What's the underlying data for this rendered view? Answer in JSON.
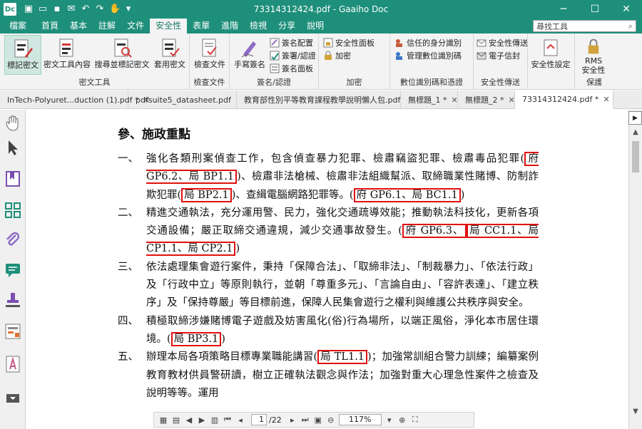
{
  "app": {
    "logo": "Dc",
    "title": "73314312424.pdf - Gaaiho Doc",
    "accent": "#1e8f7a"
  },
  "quick_access": [
    "new-doc-icon",
    "open-icon",
    "save-icon",
    "email-icon",
    "undo-icon",
    "redo-icon",
    "hand-tool-icon",
    "customize-icon"
  ],
  "window_controls": {
    "minimize": "─",
    "maximize": "☐",
    "close": "✕"
  },
  "ribbon_tabs": {
    "file": "檔案",
    "items": [
      "首頁",
      "基本",
      "註解",
      "文件",
      "安全性",
      "表單",
      "進階",
      "檢視",
      "分享",
      "說明"
    ],
    "active": "安全性"
  },
  "search": {
    "placeholder": "尋找工具"
  },
  "ribbon": {
    "redaction": {
      "label": "密文工具",
      "mark": "標記密文",
      "text_content": "密文工具內容",
      "search_mark": "搜尋並標記密文",
      "apply": "套用密文"
    },
    "check": {
      "label": "檢查文件",
      "button": "檢查文件"
    },
    "sign": {
      "label": "簽名/認證",
      "handwrite": "手寫簽名",
      "config": "簽名配置",
      "sign_certify": "簽署/認證",
      "panel": "簽名面板"
    },
    "encrypt": {
      "label": "加密",
      "panel": "安全性面板",
      "encrypt": "加密"
    },
    "digital_id": {
      "label": "數位識別碼和憑證",
      "trusted": "信任的身分識別",
      "manage": "管理數位識別碼"
    },
    "security_transmit": {
      "label": "安全性傳送",
      "transmit": "安全性傳送",
      "envelope": "電子信封"
    },
    "settings": {
      "label": "安全性設定",
      "button": "安全性設定"
    },
    "rms": {
      "label": "保護",
      "button_line1": "RMS",
      "button_line2": "安全性"
    }
  },
  "doc_tabs": [
    {
      "label": "InTech-Polyuret...duction (1).pdf *",
      "close": "✕"
    },
    {
      "label": "pdfsuite5_datasheet.pdf",
      "close": ""
    },
    {
      "label": "教育部性別平等教育課程教學說明懶人包.pdf",
      "close": ""
    },
    {
      "label": "無標題_1 *",
      "close": "✕"
    },
    {
      "label": "無標題_2 *",
      "close": "✕"
    },
    {
      "label": "73314312424.pdf *",
      "close": "✕"
    }
  ],
  "sidebar_icons": [
    "hand-icon",
    "select-arrow-icon",
    "bookmark-icon",
    "thumbnails-icon",
    "attachment-icon",
    "comments-icon",
    "stamp-icon",
    "form-fields-icon",
    "signature-icon",
    "collapse-icon"
  ],
  "document": {
    "heading": "參、施政重點",
    "items": [
      {
        "num": "一、",
        "parts": [
          {
            "t": "強化各類刑案偵查工作，包含偵查暴力犯罪、檢肅竊盜犯罪、檢肅毒品犯罪("
          },
          {
            "t": "府 GP6.2、局 BP1.1",
            "box": true
          },
          {
            "t": ")、檢肅非法槍械、檢肅非法組織幫派、取締職業性賭博、防制詐欺犯罪("
          },
          {
            "t": "局 BP2.1",
            "box": true
          },
          {
            "t": ")、查緝電腦網路犯罪等。("
          },
          {
            "t": "府 GP6.1、局 BC1.1",
            "box": true
          },
          {
            "t": ")"
          }
        ]
      },
      {
        "num": "二、",
        "parts": [
          {
            "t": "精進交通執法，充分運用警、民力，強化交通疏導效能；推動執法科技化，更新各項交通設備；嚴正取締交通違規，減少交通事故發生。("
          },
          {
            "t": "府 GP6.3、",
            "box": true
          },
          {
            "t": ""
          },
          {
            "t": "局 CC1.1、局 CP1.1、局 CP2.1",
            "box": true
          },
          {
            "t": ")"
          }
        ]
      },
      {
        "num": "三、",
        "parts": [
          {
            "t": "依法處理集會遊行案件，秉持「保障合法」、「取締非法」、「制裁暴力」、「依法行政」及「行政中立」等原則執行，並朝「尊重多元」、「言論自由」、「容許表達」、「建立秩序」及「保持尊嚴」等目標前進，保障人民集會遊行之權利與維護公共秩序與安全。"
          }
        ]
      },
      {
        "num": "四、",
        "parts": [
          {
            "t": "積極取締涉嫌賭博電子遊戲及妨害風化(俗)行為場所，以端正風俗，淨化本市居住環境。("
          },
          {
            "t": "局 BP3.1",
            "box": true
          },
          {
            "t": ")"
          }
        ]
      },
      {
        "num": "五、",
        "parts": [
          {
            "t": "辦理本局各項策略目標專業職能講習("
          },
          {
            "t": "局 TL1.1",
            "box": true
          },
          {
            "t": ")；加強常訓組合警力訓練；編纂案例教育教材供員警研讀，樹立正確執法觀念與作法；加強對重大心理急性案件之檢查及說明等等。運用"
          }
        ]
      }
    ]
  },
  "bottom_nav": {
    "current_page": "1",
    "total_pages": "/22",
    "zoom": "117%"
  }
}
